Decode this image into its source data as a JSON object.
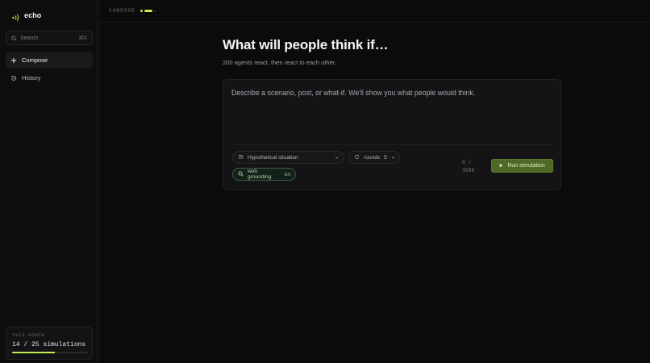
{
  "app": {
    "name": "echo",
    "accent": "#c5ee57"
  },
  "sidebar": {
    "search": {
      "placeholder": "Search",
      "shortcut": "⌘K"
    },
    "items": [
      {
        "label": "Compose",
        "icon": "plus-icon",
        "active": true
      },
      {
        "label": "History",
        "icon": "history-icon",
        "active": false
      }
    ],
    "usage": {
      "label": "THIS MONTH",
      "count_text": "14 / 25 simulations",
      "used": 14,
      "limit": 25
    }
  },
  "topbar": {
    "breadcrumb": "COMPOSE"
  },
  "main": {
    "title": "What will people think if…",
    "subtitle": "200 agents react, then react to each other.",
    "composer": {
      "placeholder": "Describe a scenario, post, or what-if. We'll show you what people would think.",
      "situation": {
        "label": "Hypothetical situation",
        "icon": "people-icon"
      },
      "rounds": {
        "label": "rounds",
        "value": "5"
      },
      "grounding": {
        "label": "web grounding",
        "state": "on"
      },
      "counter": {
        "current": "0 /",
        "max": "3500"
      },
      "run_label": "Run simulation"
    }
  }
}
